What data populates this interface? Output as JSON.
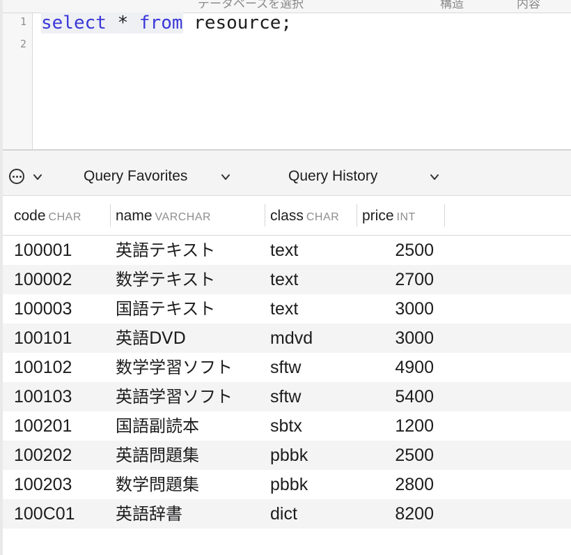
{
  "top_bar": {
    "items": [
      "データベースを選択",
      "構造",
      "内容"
    ]
  },
  "editor": {
    "line_numbers": [
      "1",
      "2"
    ],
    "line1": {
      "kw_select": "select",
      "star": " * ",
      "kw_from": "from",
      "rest": " resource;"
    }
  },
  "toolbar": {
    "more_icon": "ellipsis-circle-icon",
    "favorites_label": "Query Favorites",
    "history_label": "Query History"
  },
  "table": {
    "columns": [
      {
        "name": "code",
        "type": "CHAR"
      },
      {
        "name": "name",
        "type": "VARCHAR"
      },
      {
        "name": "class",
        "type": "CHAR"
      },
      {
        "name": "price",
        "type": "INT"
      }
    ],
    "rows": [
      {
        "code": "100001",
        "name": "英語テキスト",
        "class": "text",
        "price": "2500"
      },
      {
        "code": "100002",
        "name": "数学テキスト",
        "class": "text",
        "price": "2700"
      },
      {
        "code": "100003",
        "name": "国語テキスト",
        "class": "text",
        "price": "3000"
      },
      {
        "code": "100101",
        "name": "英語DVD",
        "class": "mdvd",
        "price": "3000"
      },
      {
        "code": "100102",
        "name": "数学学習ソフト",
        "class": "sftw",
        "price": "4900"
      },
      {
        "code": "100103",
        "name": "英語学習ソフト",
        "class": "sftw",
        "price": "5400"
      },
      {
        "code": "100201",
        "name": "国語副読本",
        "class": "sbtx",
        "price": "1200"
      },
      {
        "code": "100202",
        "name": "英語問題集",
        "class": "pbbk",
        "price": "2500"
      },
      {
        "code": "100203",
        "name": "数学問題集",
        "class": "pbbk",
        "price": "2800"
      },
      {
        "code": "100C01",
        "name": "英語辞書",
        "class": "dict",
        "price": "8200"
      }
    ]
  }
}
